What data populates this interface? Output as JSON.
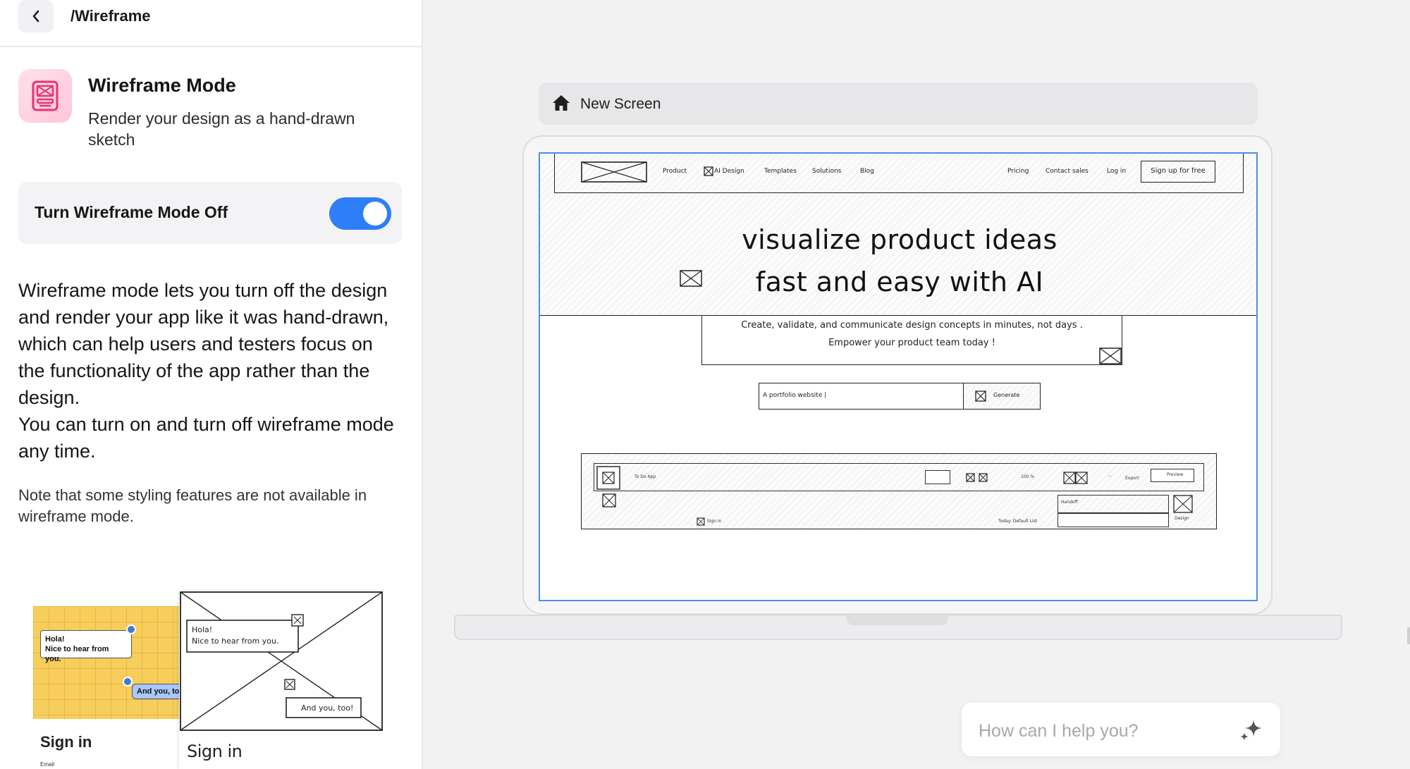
{
  "header": {
    "breadcrumb": "/Wireframe"
  },
  "mode": {
    "title": "Wireframe Mode",
    "description": "Render your design as a hand-drawn sketch",
    "toggle_label": "Turn Wireframe Mode Off",
    "toggle_state": "on"
  },
  "info": {
    "body": "Wireframe mode lets you turn off the design and render your app like it was hand-drawn, which can help users and testers focus on the functionality of the app rather than the design.\nYou can turn on and turn off wireframe mode any time.",
    "note": "Note that some styling features are not available in wireframe mode."
  },
  "preview": {
    "bubble1": "Hola!\nNice to hear from you.",
    "bubble2": "And you, to",
    "signin": "Sign in",
    "email_label": "Email",
    "sketch_bubble1": "Hola!\nNice to hear from you.",
    "sketch_bubble2": "And you, too!",
    "sketch_signin": "Sign in"
  },
  "canvas": {
    "screen_name": "New Screen",
    "nav": {
      "items": [
        "Product",
        "AI Design",
        "Templates",
        "Solutions",
        "Blog"
      ],
      "right_items": [
        "Pricing",
        "Contact sales",
        "Log in"
      ],
      "cta": "Sign up for free"
    },
    "hero": {
      "title_line1": "visualize product ideas",
      "title_line2": "fast and easy with AI",
      "subtitle_line1": "Create, validate, and communicate design concepts in minutes, not days .",
      "subtitle_line2": "Empower your product team today !",
      "prompt_value": "A portfolio website |",
      "generate_label": "Generate"
    },
    "app_preview": {
      "app_name": "To Do App",
      "handoff": "Handoff",
      "design": "Design",
      "sign_in": "Sign in",
      "today": "Today: Default List",
      "preview": "Preview",
      "export": "Export",
      "zoom": "100 %",
      "dots": "..."
    }
  },
  "chat": {
    "placeholder": "How can I help you?"
  },
  "colors": {
    "accent": "#2d7ef7",
    "selection": "#4a90e8",
    "mode_icon_bg": "#ffc6da",
    "mode_icon_fg": "#e8336e"
  },
  "icons": [
    "chevron-left-icon",
    "wireframe-mode-icon",
    "home-icon",
    "sparkle-icon",
    "image-placeholder-icon"
  ]
}
